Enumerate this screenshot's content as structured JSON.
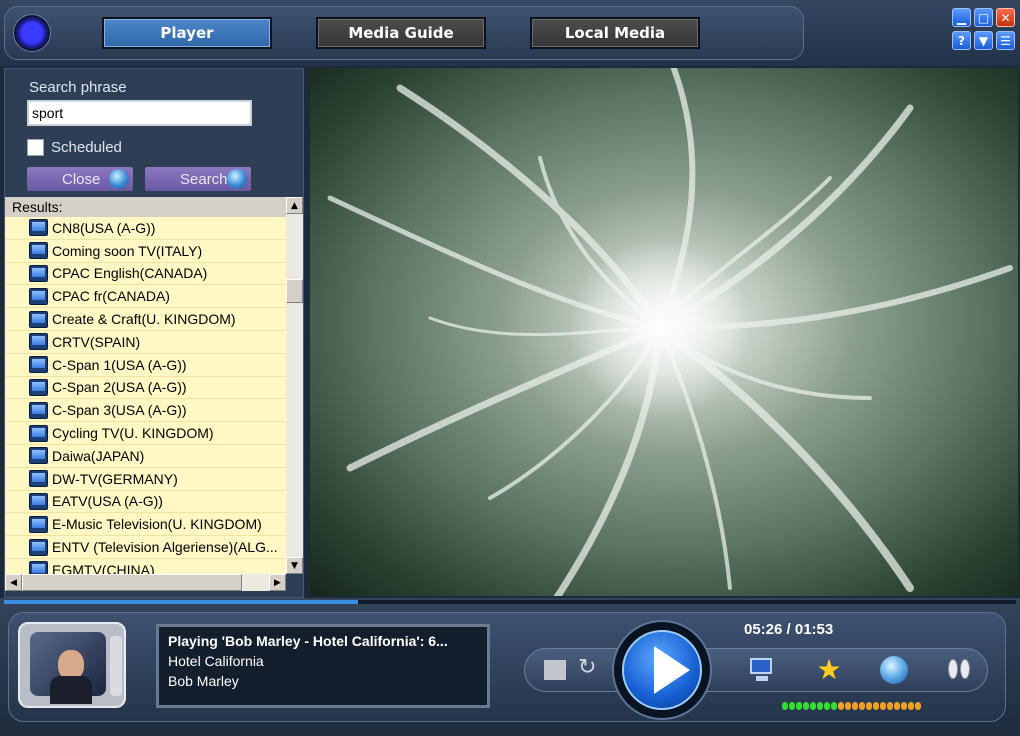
{
  "header": {
    "tabs": [
      {
        "label": "Player",
        "active": true
      },
      {
        "label": "Media Guide",
        "active": false
      },
      {
        "label": "Local Media",
        "active": false
      }
    ],
    "window_buttons": [
      {
        "icon": "minimize-icon",
        "glyph": "▁"
      },
      {
        "icon": "maximize-icon",
        "glyph": "□"
      },
      {
        "icon": "close-icon",
        "glyph": "✕"
      },
      {
        "icon": "help-icon",
        "glyph": "?"
      },
      {
        "icon": "dropdown-icon",
        "glyph": "▼"
      },
      {
        "icon": "menu-icon",
        "glyph": "☰"
      }
    ]
  },
  "search": {
    "label": "Search phrase",
    "value": "sport",
    "scheduled_label": "Scheduled",
    "scheduled_checked": false,
    "close_label": "Close",
    "search_label": "Search"
  },
  "results": {
    "header": "Results:",
    "items": [
      "CN8(USA (A-G))",
      "Coming soon TV(ITALY)",
      "CPAC English(CANADA)",
      "CPAC fr(CANADA)",
      "Create & Craft(U. KINGDOM)",
      "CRTV(SPAIN)",
      "C-Span 1(USA (A-G))",
      "C-Span 2(USA (A-G))",
      "C-Span 3(USA (A-G))",
      "Cycling TV(U. KINGDOM)",
      "Daiwa(JAPAN)",
      "DW-TV(GERMANY)",
      "EATV(USA (A-G))",
      "E-Music Television(U. KINGDOM)",
      "ENTV (Television Algeriense)(ALG...",
      "EGMTV(CHINA)"
    ]
  },
  "now_playing": {
    "status": "Playing 'Bob Marley - Hotel California': 6...",
    "title": "Hotel California",
    "artist": "Bob Marley"
  },
  "playback": {
    "time": "05:26 / 01:53",
    "progress_fraction": 0.35,
    "level_meter": {
      "green": 8,
      "orange": 12
    }
  },
  "colors": {
    "accent": "#3a8de0",
    "tab_active": "#2f67a8",
    "results_bg": "#fff8c4",
    "meter_green": "#33dd33",
    "meter_orange": "#f0a020"
  }
}
